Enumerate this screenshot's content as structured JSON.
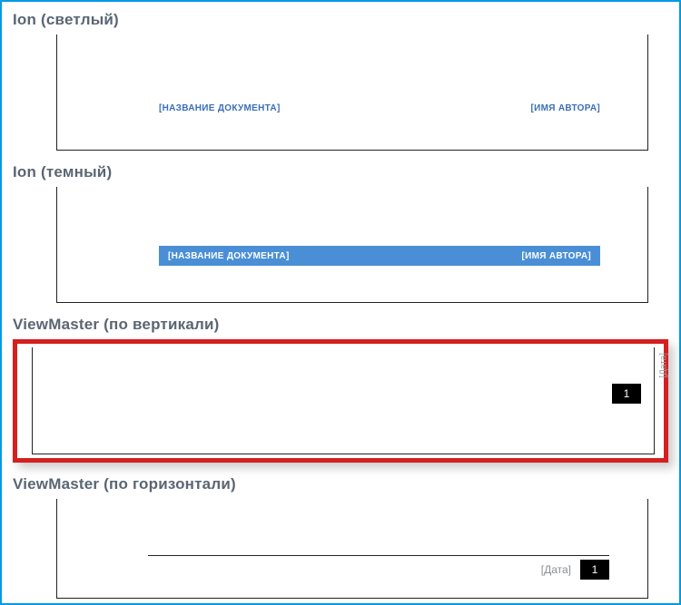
{
  "options": {
    "ion_light": {
      "label": "Ion (светлый)",
      "doc_name": "[НАЗВАНИЕ ДОКУМЕНТА]",
      "author": "[ИМЯ АВТОРА]"
    },
    "ion_dark": {
      "label": "Ion (темный)",
      "doc_name": "[НАЗВАНИЕ ДОКУМЕНТА]",
      "author": "[ИМЯ АВТОРА]"
    },
    "vm_vertical": {
      "label": "ViewMaster (по вертикали)",
      "date": "[Дата]",
      "page": "1"
    },
    "vm_horizontal": {
      "label": "ViewMaster (по горизонтали)",
      "date": "[Дата]",
      "page": "1"
    }
  }
}
